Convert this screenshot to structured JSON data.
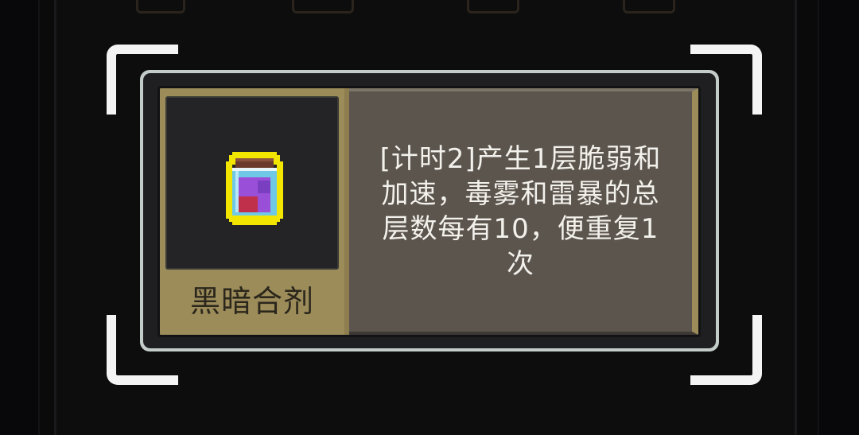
{
  "tooltip": {
    "item_name": "黑暗合剂",
    "item_icon": "potion-icon",
    "description": "[计时2]产生1层脆弱和加速，毒雾和雷暴的总层数每有10，便重复1次"
  },
  "colors": {
    "frame": "#c4ccc9",
    "item_panel": "#9c8c5a",
    "description_panel": "#5c554e",
    "selection_bracket": "#f4f4f4",
    "potion_outline": "#f2e600",
    "potion_liquid": "#9a4fd8"
  }
}
